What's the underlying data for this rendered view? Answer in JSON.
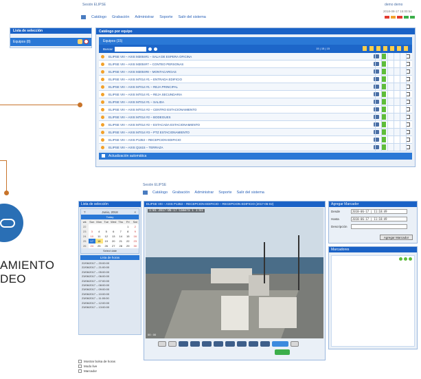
{
  "top": {
    "brand": "Sesión ELIPSE",
    "user": "demo demo",
    "datetime": "2018-08-17 15:00:54",
    "flag_colors": [
      "#e23b2e",
      "#f2a12b",
      "#e23b2e",
      "#3cae4a",
      "#3cae4a"
    ],
    "nav": [
      "Catálogo",
      "Grabación",
      "Administrar",
      "Soporte",
      "Salir del sistema"
    ],
    "left_panel": {
      "title": "Lista de selección",
      "item": "Equipos (8)"
    },
    "main_panel": {
      "title": "Catálogo por equipo",
      "group": "Equipos (15)",
      "search_label": "Buscar",
      "pager": "15 | 15 | 15",
      "rows": [
        "ELIPSE VIII – AXIS M3004#1 – SALA DE ESPERA OFICINA",
        "ELIPSE VIII – AXIS M3004#7 – CONTEO PERSONAS",
        "ELIPSE VIII – AXIS M3004#8 – MONTACARGAS",
        "ELIPSE VIII – AXIS M7014 #1 – ENTRADA EDIFICIO",
        "ELIPSE VIII – AXIS M7014 #1 – REJA PRINCIPAL",
        "ELIPSE VIII – AXIS M7014 #1 – REJA SECUNDARIA",
        "ELIPSE VIII – AXIS M7014 #1 – SALIDA",
        "ELIPSE VIII – AXIS M7014 #2 – CENTRO ESTACIONAMIENTO",
        "ELIPSE VIII – AXIS M7014 #2 – BODEGUES",
        "ELIPSE VIII – AXIS M7014 #2 – ESTACADA ESTACIONAMIENTO",
        "ELIPSE VIII – AXIS M7014 #3 – PTZ ESTACIONAMIENTO",
        "ELIPSE VIII – AXIS P1353 – RECEPCION EDIFICIO",
        "ELIPSE VIII – AXIS Q1615 – TERRAZA"
      ],
      "auto_update": "Actualización automática"
    }
  },
  "side": {
    "label_line1": "AMIENTO",
    "label_line2": "DEO"
  },
  "bottom": {
    "brand": "Sesión ELIPSE",
    "nav": [
      "Catálogo",
      "Grabación",
      "Administrar",
      "Soporte",
      "Salir del sistema"
    ],
    "left_panel": {
      "title": "Lista de selección",
      "calendar_month": "Junio, 2018",
      "calendar_nav": "Today",
      "weekdays": [
        "wk",
        "Sun",
        "Mon",
        "Tue",
        "Wed",
        "Thu",
        "Fri",
        "Sat"
      ],
      "weeks": [
        [
          "22",
          "",
          "",
          "",
          "",
          "",
          "1",
          "2"
        ],
        [
          "23",
          "3",
          "4",
          "5",
          "6",
          "7",
          "8",
          "9"
        ],
        [
          "24",
          "10",
          "11",
          "12",
          "13",
          "14",
          "15",
          "16"
        ],
        [
          "25",
          "17",
          "18",
          "19",
          "20",
          "21",
          "22",
          "23"
        ],
        [
          "26",
          "24",
          "25",
          "26",
          "27",
          "28",
          "29",
          "30"
        ]
      ],
      "select_date": "Select date",
      "hours_title": "Lista de horas",
      "hours": [
        "22/06/2017 – 20:00:00",
        "22/06/2017 – 21:00:00",
        "23/06/2017 – 05:00:00",
        "23/06/2017 – 06:00:00",
        "23/06/2017 – 07:00:00",
        "23/06/2017 – 08:00:00",
        "23/06/2017 – 09:00:00",
        "23/06/2017 – 10:00:00",
        "23/06/2017 – 11:00:00",
        "23/06/2017 – 12:00:00",
        "23/06/2017 – 13:00:00"
      ],
      "options": [
        "Mostrar bolsa de horas",
        "Modo live",
        "Marcador"
      ]
    },
    "video": {
      "title": "ELIPSE VIII – AXIS P1353 – RECEPCION EDIFICIO – RECEPCION EDIFICIO (2017-06-02)",
      "overlay": "1:01 2017-06-17 Camera 1 1:01",
      "time": "00 : 00"
    },
    "add_marker": {
      "title": "Agregar Marcador",
      "from_label": "Desde",
      "from_value": "2018-06-17 | 11:18:49",
      "to_label": "Hasta",
      "to_value": "2018-06-17 | 11:18:49",
      "desc_label": "Descripción",
      "button": "Agregar Marcador"
    },
    "markers": {
      "title": "Marcadores"
    }
  }
}
